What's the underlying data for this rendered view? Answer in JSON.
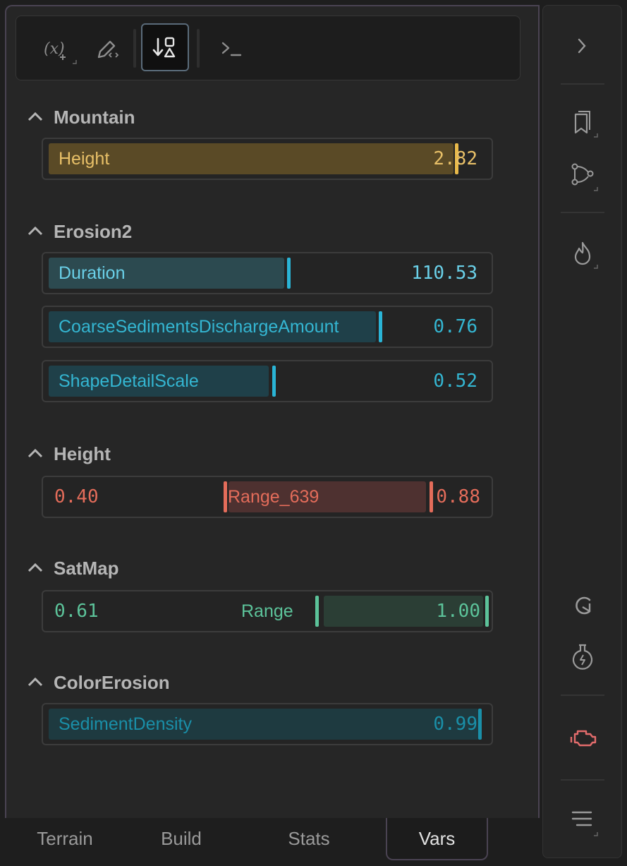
{
  "toolbar": {
    "buttons": [
      {
        "name": "add-variable-icon"
      },
      {
        "name": "edit-icon"
      },
      {
        "name": "sort-shapes-icon",
        "active": true
      },
      {
        "name": "terminal-icon"
      }
    ]
  },
  "sections": {
    "mountain": {
      "title": "Mountain",
      "fields": [
        {
          "label": "Height",
          "value": "2.82",
          "level": 0.906
        }
      ]
    },
    "erosion2": {
      "title": "Erosion2",
      "fields": [
        {
          "label": "Duration",
          "value": "110.53",
          "level": 0.525
        },
        {
          "label": "CoarseSedimentsDischargeAmount",
          "value": "0.76",
          "level": 0.74
        },
        {
          "label": "ShapeDetailScale",
          "value": "0.52",
          "level": 0.5
        }
      ]
    },
    "height": {
      "title": "Height",
      "fields": [
        {
          "label": "Range_639",
          "min": "0.40",
          "max": "0.88"
        }
      ]
    },
    "satmap": {
      "title": "SatMap",
      "fields": [
        {
          "label": "Range",
          "min": "0.61",
          "max": "1.00"
        }
      ]
    },
    "colorerosion": {
      "title": "ColorErosion",
      "fields": [
        {
          "label": "SedimentDensity",
          "value": "0.99",
          "level": 0.99
        }
      ]
    }
  },
  "tabs": [
    {
      "label": "Terrain"
    },
    {
      "label": "Build"
    },
    {
      "label": "Stats"
    },
    {
      "label": "Vars",
      "active": true
    }
  ],
  "rail": {
    "icons": [
      "chevron-right-icon",
      "bookmark-icon",
      "node-graph-icon",
      "flame-icon",
      "refresh-icon",
      "flask-icon",
      "engine-icon",
      "menu-icon"
    ]
  },
  "colors": {
    "mountain": "#e8b94a",
    "erosion": "#2ab4d6",
    "height_range": "#e36c5a",
    "satmap": "#5cc39a",
    "sediment": "#1a8fa8"
  }
}
